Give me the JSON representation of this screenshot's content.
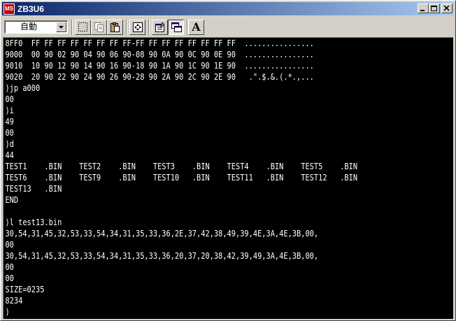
{
  "window": {
    "title": "ZB3U6",
    "icon_label": "MS"
  },
  "toolbar": {
    "font_size_select": "自動",
    "font_button_label": "A"
  },
  "console": {
    "lines": [
      "8FF0  FF FF FF FF FF FF FF FF-FF FF FF FF FF FF FF FF  ................",
      "9000  00 90 02 90 04 90 06 90-08 90 0A 90 0C 90 0E 90  ................",
      "9010  10 90 12 90 14 90 16 90-18 90 1A 90 1C 90 1E 90  ................",
      "9020  20 90 22 90 24 90 26 90-28 90 2A 90 2C 90 2E 90   .\".$.&.(.*.,...",
      ")jp a000",
      "00",
      ")i",
      "49",
      "00",
      ")d",
      "44",
      "TEST1    .BIN    TEST2    .BIN    TEST3    .BIN    TEST4    .BIN    TEST5    .BIN",
      "TEST6    .BIN    TEST9    .BIN    TEST10   .BIN    TEST11   .BIN    TEST12   .BIN",
      "TEST13   .BIN",
      "END",
      "",
      ")l test13.bin",
      "30,54,31,45,32,53,33,54,34,31,35,33,36,2E,37,42,38,49,39,4E,3A,4E,3B,00,",
      "00",
      "30,54,31,45,32,53,33,54,34,31,35,33,36,20,37,20,38,42,39,49,3A,4E,3B,00,",
      "00",
      "00",
      "SIZE=0235",
      "8234",
      ")"
    ]
  },
  "colors": {
    "console_bg": "#000000",
    "console_fg": "#ffffff",
    "titlebar_start": "#0a246a",
    "titlebar_end": "#a6caf0",
    "chrome": "#d4d0c8"
  }
}
